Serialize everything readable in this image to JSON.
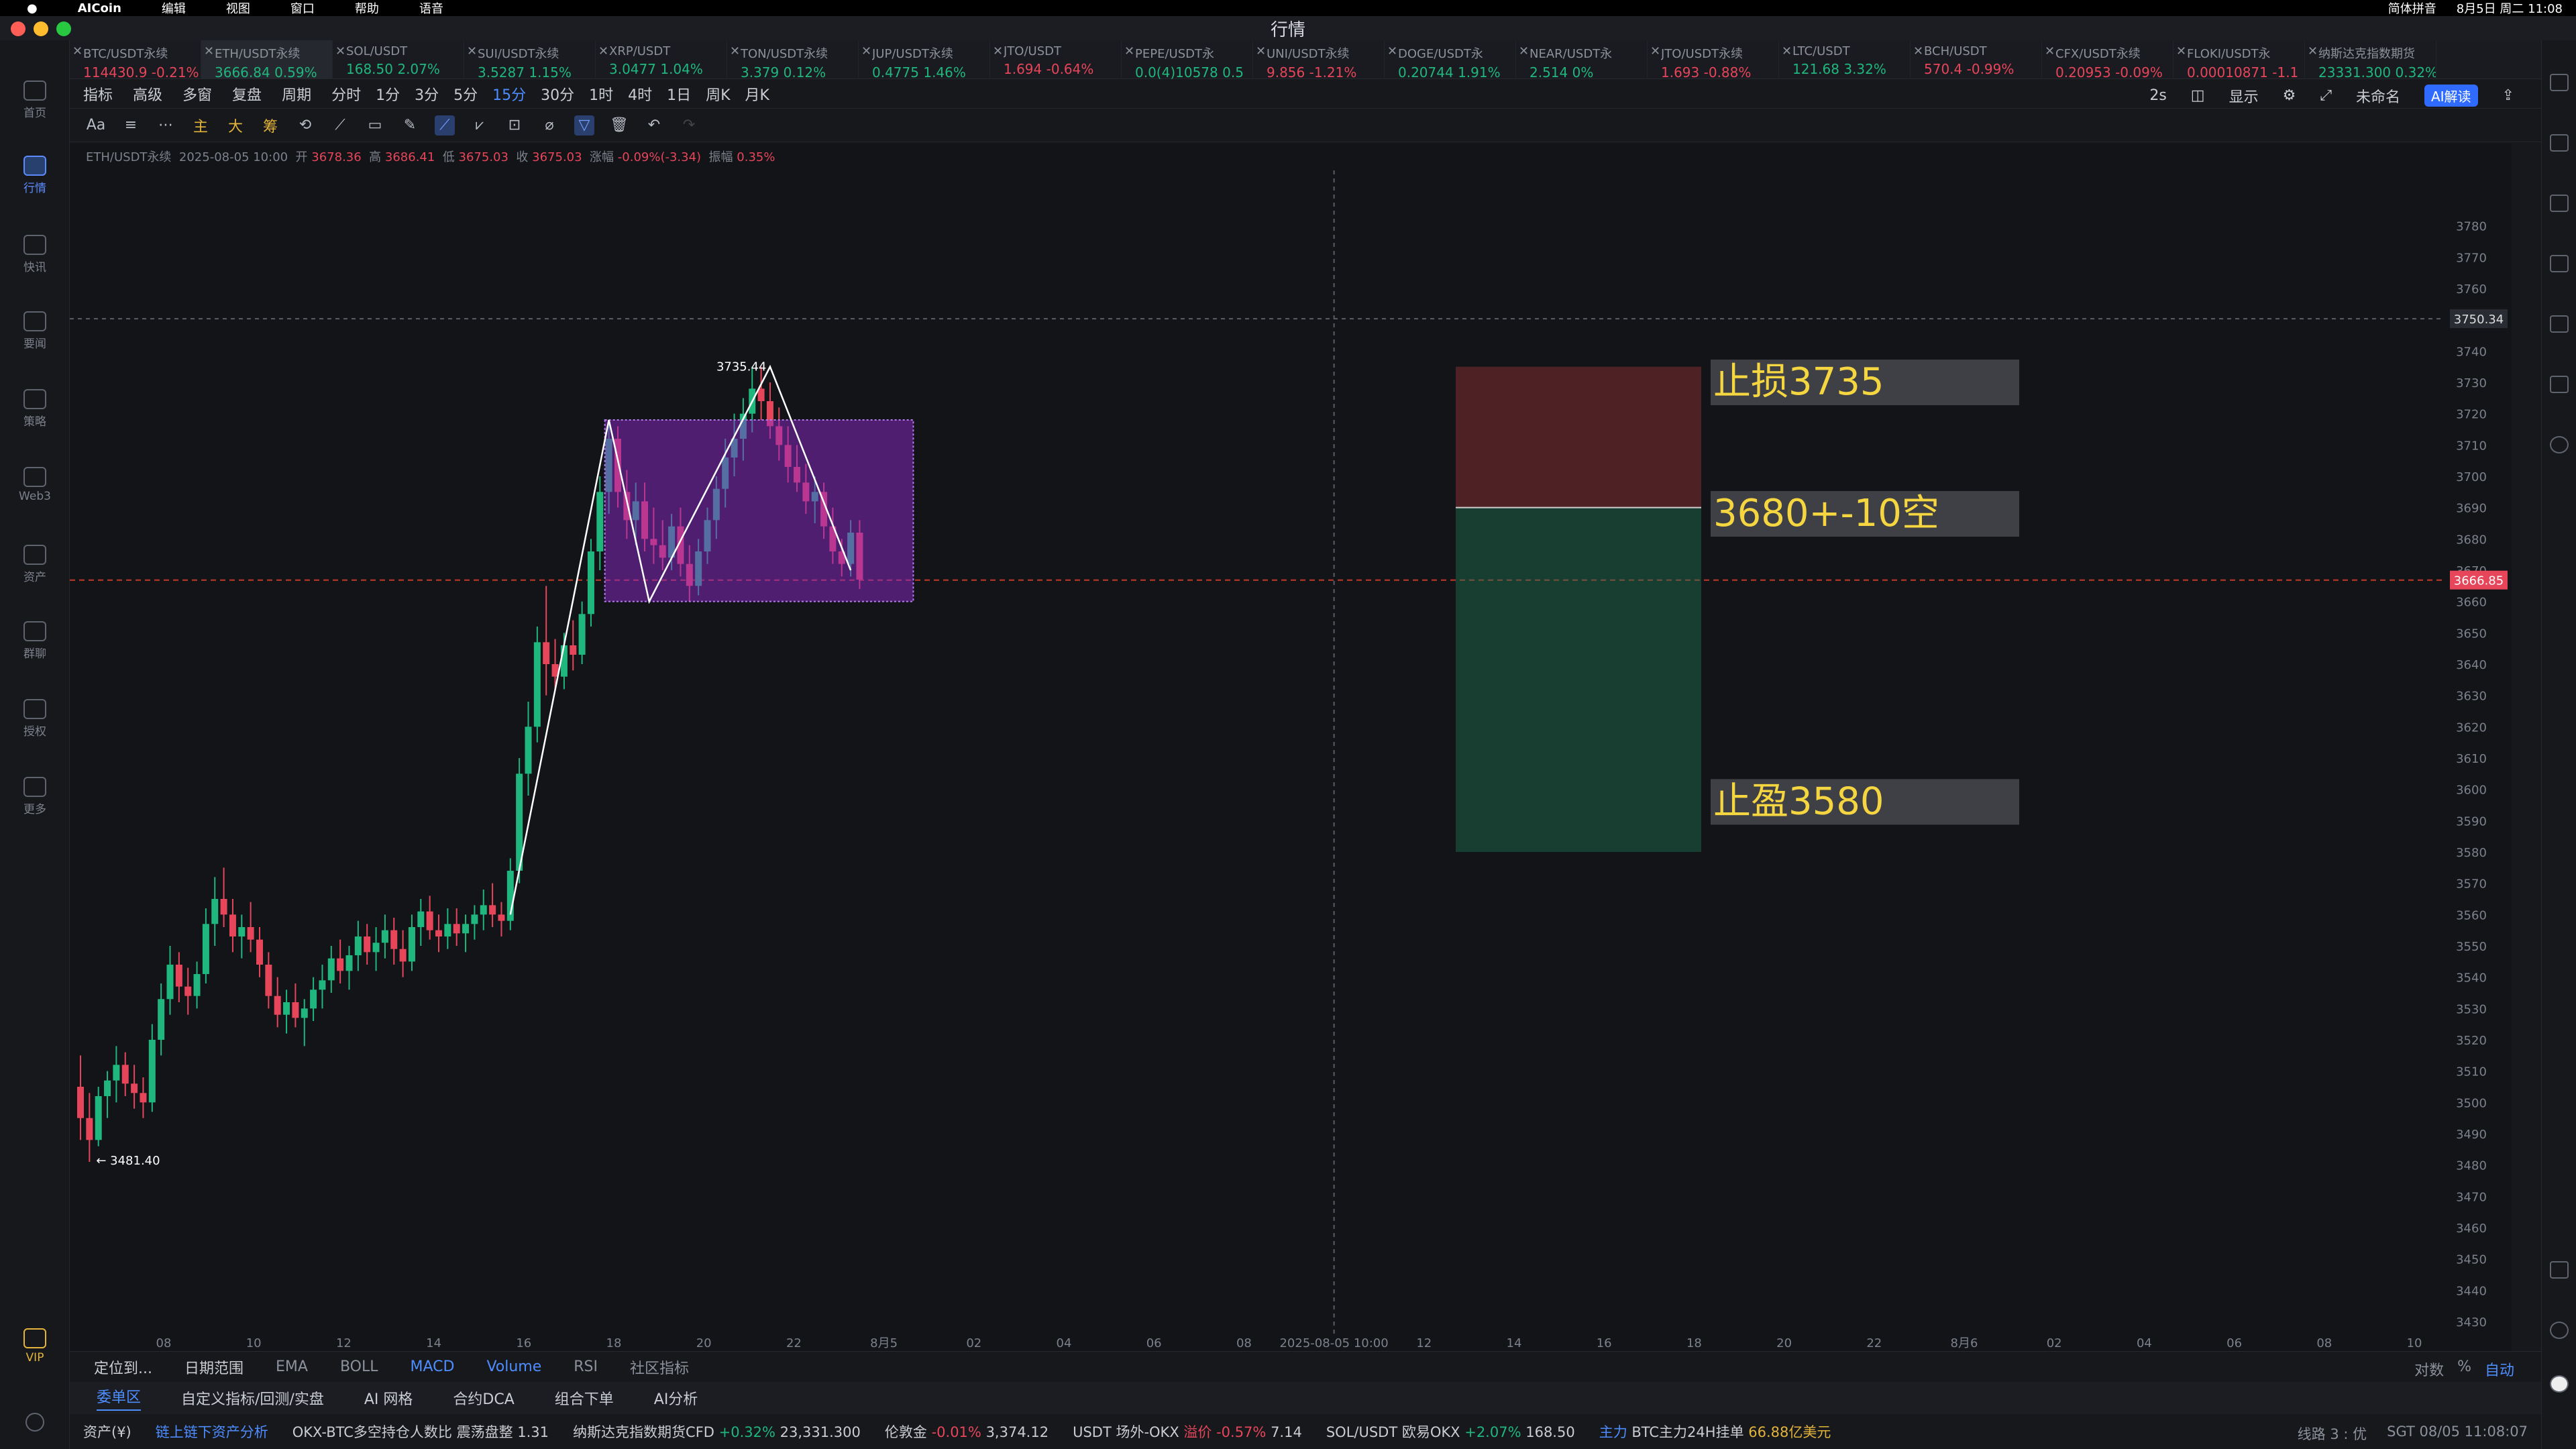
{
  "mac": {
    "app": "AICoin",
    "menus": [
      "编辑",
      "视图",
      "窗口",
      "帮助",
      "语音"
    ],
    "ime": "简体拼音",
    "datetime": "8月5日 周二 11:08"
  },
  "window": {
    "title": "行情"
  },
  "sidebar": {
    "items": [
      {
        "label": "首页",
        "icon": "home-icon"
      },
      {
        "label": "行情",
        "icon": "chart-icon",
        "active": true
      },
      {
        "label": "快讯",
        "icon": "flash-icon"
      },
      {
        "label": "要闻",
        "icon": "news-icon"
      },
      {
        "label": "策略",
        "icon": "strategy-icon"
      },
      {
        "label": "Web3",
        "icon": "web3-icon"
      },
      {
        "label": "资产",
        "icon": "wallet-icon"
      },
      {
        "label": "群聊",
        "icon": "chat-icon"
      },
      {
        "label": "授权",
        "icon": "auth-icon"
      },
      {
        "label": "更多",
        "icon": "more-icon"
      },
      {
        "label": "VIP",
        "icon": "vip-icon"
      }
    ]
  },
  "tickers": [
    {
      "name": "BTC/USDT永续",
      "price": "114430.9",
      "change": "-0.21%",
      "dir": "dn"
    },
    {
      "name": "ETH/USDT永续",
      "price": "3666.84",
      "change": "0.59%",
      "dir": "up",
      "active": true
    },
    {
      "name": "SOL/USDT",
      "price": "168.50",
      "change": "2.07%",
      "dir": "up"
    },
    {
      "name": "SUI/USDT永续",
      "price": "3.5287",
      "change": "1.15%",
      "dir": "up"
    },
    {
      "name": "XRP/USDT",
      "price": "3.0477",
      "change": "1.04%",
      "dir": "up"
    },
    {
      "name": "TON/USDT永续",
      "price": "3.379",
      "change": "0.12%",
      "dir": "up"
    },
    {
      "name": "JUP/USDT永续",
      "price": "0.4775",
      "change": "1.46%",
      "dir": "up"
    },
    {
      "name": "JTO/USDT",
      "price": "1.694",
      "change": "-0.64%",
      "dir": "dn"
    },
    {
      "name": "PEPE/USDT永",
      "price": "0.0(4)10578",
      "change": "0.5",
      "dir": "up"
    },
    {
      "name": "UNI/USDT永续",
      "price": "9.856",
      "change": "-1.21%",
      "dir": "dn"
    },
    {
      "name": "DOGE/USDT永",
      "price": "0.20744",
      "change": "1.91%",
      "dir": "up"
    },
    {
      "name": "NEAR/USDT永",
      "price": "2.514",
      "change": "0%",
      "dir": "up"
    },
    {
      "name": "JTO/USDT永续",
      "price": "1.693",
      "change": "-0.88%",
      "dir": "dn"
    },
    {
      "name": "LTC/USDT",
      "price": "121.68",
      "change": "3.32%",
      "dir": "up"
    },
    {
      "name": "BCH/USDT",
      "price": "570.4",
      "change": "-0.99%",
      "dir": "dn"
    },
    {
      "name": "CFX/USDT永续",
      "price": "0.20953",
      "change": "-0.09%",
      "dir": "dn"
    },
    {
      "name": "FLOKI/USDT永",
      "price": "0.00010871",
      "change": "-1.1",
      "dir": "dn"
    },
    {
      "name": "纳斯达克指数期货",
      "price": "23331.300",
      "change": "0.32%",
      "dir": "up"
    }
  ],
  "toolbar": {
    "items": [
      "指标",
      "高级",
      "多窗",
      "复盘",
      "周期"
    ],
    "intervals": [
      "分时",
      "1分",
      "3分",
      "5分",
      "15分",
      "30分",
      "1时",
      "4时",
      "1日",
      "周K",
      "月K"
    ],
    "active_interval": "15分",
    "right": [
      "2s",
      "显示",
      "未命名"
    ],
    "ai_label": "AI解读",
    "draw_tools": [
      "Aa",
      "主",
      "大",
      "筹"
    ]
  },
  "infoline": {
    "symbol": "ETH/USDT永续",
    "time": "2025-08-05 10:00",
    "open_label": "开",
    "open": "3678.36",
    "high_label": "高",
    "high": "3686.41",
    "low_label": "低",
    "low": "3675.03",
    "close_label": "收",
    "close": "3675.03",
    "chg_label": "涨幅",
    "chg": "-0.09%(-3.34)",
    "amp_label": "振幅",
    "amp": "0.35%"
  },
  "chart_data": {
    "type": "candlestick",
    "symbol": "ETH/USDT永续",
    "interval": "15分",
    "ylim": [
      3430,
      3790
    ],
    "y_ticks": [
      3780,
      3770,
      3760,
      3750,
      3740,
      3730,
      3720,
      3710,
      3700,
      3690,
      3680,
      3670,
      3660,
      3650,
      3640,
      3630,
      3620,
      3610,
      3600,
      3590,
      3580,
      3570,
      3560,
      3550,
      3540,
      3530,
      3520,
      3510,
      3500,
      3490,
      3480,
      3470,
      3460,
      3450,
      3440,
      3430
    ],
    "x_ticks": [
      "08",
      "10",
      "12",
      "14",
      "16",
      "18",
      "20",
      "22",
      "8月5",
      "02",
      "04",
      "06",
      "08",
      "2025-08-05 10:00",
      "12",
      "14",
      "16",
      "18",
      "20",
      "22",
      "8月6",
      "02",
      "04",
      "06",
      "08",
      "10"
    ],
    "crosshair_price": "3750.34",
    "current_price": "3666.85",
    "high_label": "3735.44",
    "low_label": "3481.40",
    "candles": [
      [
        3505,
        3515,
        3488,
        3495
      ],
      [
        3495,
        3503,
        3481,
        3488
      ],
      [
        3488,
        3505,
        3486,
        3502
      ],
      [
        3502,
        3510,
        3495,
        3507
      ],
      [
        3507,
        3518,
        3500,
        3512
      ],
      [
        3512,
        3516,
        3502,
        3506
      ],
      [
        3506,
        3512,
        3498,
        3503
      ],
      [
        3503,
        3508,
        3495,
        3500
      ],
      [
        3500,
        3525,
        3497,
        3520
      ],
      [
        3520,
        3538,
        3515,
        3533
      ],
      [
        3533,
        3550,
        3528,
        3544
      ],
      [
        3544,
        3548,
        3532,
        3537
      ],
      [
        3537,
        3543,
        3528,
        3534
      ],
      [
        3534,
        3545,
        3530,
        3541
      ],
      [
        3541,
        3562,
        3538,
        3557
      ],
      [
        3557,
        3572,
        3550,
        3565
      ],
      [
        3565,
        3575,
        3556,
        3560
      ],
      [
        3560,
        3565,
        3548,
        3553
      ],
      [
        3553,
        3560,
        3546,
        3556
      ],
      [
        3556,
        3564,
        3548,
        3552
      ],
      [
        3552,
        3556,
        3540,
        3544
      ],
      [
        3544,
        3548,
        3530,
        3534
      ],
      [
        3534,
        3540,
        3524,
        3528
      ],
      [
        3528,
        3536,
        3522,
        3532
      ],
      [
        3532,
        3538,
        3524,
        3527
      ],
      [
        3527,
        3533,
        3518,
        3530
      ],
      [
        3530,
        3540,
        3526,
        3536
      ],
      [
        3536,
        3544,
        3530,
        3539
      ],
      [
        3539,
        3550,
        3535,
        3546
      ],
      [
        3546,
        3552,
        3538,
        3542
      ],
      [
        3542,
        3550,
        3536,
        3547
      ],
      [
        3547,
        3558,
        3542,
        3553
      ],
      [
        3553,
        3557,
        3544,
        3548
      ],
      [
        3548,
        3556,
        3542,
        3551
      ],
      [
        3551,
        3560,
        3546,
        3555
      ],
      [
        3555,
        3559,
        3544,
        3549
      ],
      [
        3549,
        3555,
        3540,
        3545
      ],
      [
        3545,
        3560,
        3542,
        3556
      ],
      [
        3556,
        3565,
        3550,
        3561
      ],
      [
        3561,
        3566,
        3552,
        3555
      ],
      [
        3555,
        3560,
        3548,
        3553
      ],
      [
        3553,
        3562,
        3549,
        3557
      ],
      [
        3557,
        3562,
        3550,
        3554
      ],
      [
        3554,
        3560,
        3548,
        3557
      ],
      [
        3557,
        3563,
        3552,
        3560
      ],
      [
        3560,
        3568,
        3555,
        3563
      ],
      [
        3563,
        3570,
        3556,
        3560
      ],
      [
        3560,
        3564,
        3553,
        3558
      ],
      [
        3558,
        3578,
        3555,
        3574
      ],
      [
        3574,
        3610,
        3570,
        3605
      ],
      [
        3605,
        3628,
        3598,
        3620
      ],
      [
        3620,
        3652,
        3615,
        3647
      ],
      [
        3647,
        3665,
        3630,
        3640
      ],
      [
        3640,
        3648,
        3632,
        3636
      ],
      [
        3636,
        3650,
        3632,
        3646
      ],
      [
        3646,
        3654,
        3638,
        3643
      ],
      [
        3643,
        3660,
        3640,
        3656
      ],
      [
        3656,
        3680,
        3652,
        3676
      ],
      [
        3676,
        3700,
        3670,
        3695
      ],
      [
        3695,
        3718,
        3688,
        3712
      ],
      [
        3712,
        3716,
        3690,
        3695
      ],
      [
        3695,
        3702,
        3680,
        3686
      ],
      [
        3686,
        3698,
        3678,
        3692
      ],
      [
        3692,
        3698,
        3676,
        3680
      ],
      [
        3680,
        3690,
        3672,
        3678
      ],
      [
        3678,
        3686,
        3670,
        3674
      ],
      [
        3674,
        3688,
        3670,
        3684
      ],
      [
        3684,
        3690,
        3668,
        3672
      ],
      [
        3672,
        3678,
        3660,
        3665
      ],
      [
        3665,
        3680,
        3662,
        3676
      ],
      [
        3676,
        3690,
        3672,
        3686
      ],
      [
        3686,
        3700,
        3680,
        3696
      ],
      [
        3696,
        3712,
        3690,
        3706
      ],
      [
        3706,
        3720,
        3700,
        3712
      ],
      [
        3712,
        3725,
        3705,
        3720
      ],
      [
        3720,
        3735,
        3714,
        3728
      ],
      [
        3728,
        3735,
        3718,
        3724
      ],
      [
        3724,
        3730,
        3712,
        3716
      ],
      [
        3716,
        3722,
        3705,
        3710
      ],
      [
        3710,
        3716,
        3698,
        3703
      ],
      [
        3703,
        3710,
        3695,
        3698
      ],
      [
        3698,
        3704,
        3688,
        3692
      ],
      [
        3692,
        3700,
        3685,
        3695
      ],
      [
        3695,
        3698,
        3680,
        3684
      ],
      [
        3684,
        3690,
        3672,
        3676
      ],
      [
        3676,
        3680,
        3668,
        3672
      ],
      [
        3672,
        3686,
        3668,
        3682
      ],
      [
        3682,
        3686,
        3664,
        3667
      ]
    ]
  },
  "annotations": {
    "stop_loss": "止损3735",
    "entry": "3680+-10空",
    "take_profit": "止盈3580"
  },
  "bottombar": {
    "left": [
      "定位到...",
      "日期范围"
    ],
    "indicators": [
      "EMA",
      "BOLL",
      "MACD",
      "Volume",
      "RSI",
      "社区指标"
    ],
    "right": [
      "对数",
      "%",
      "自动"
    ]
  },
  "statusrow": [
    "委单区",
    "自定义指标/回测/实盘",
    "AI 网格",
    "合约DCA",
    "组合下单",
    "AI分析"
  ],
  "footer": {
    "assets": "资产(¥)",
    "link": "链上链下资产分析",
    "items": [
      {
        "label": "OKX-BTC多空持仓人数比",
        "tag": "震荡盘整",
        "value": "1.31"
      },
      {
        "label": "纳斯达克指数期货CFD",
        "tag": "+0.32%",
        "value": "23,331.300"
      },
      {
        "label": "伦敦金",
        "tag": "-0.01%",
        "value": "3,374.12"
      },
      {
        "label": "USDT 场外-OKX",
        "tag": "溢价 -0.57%",
        "value": "7.14"
      },
      {
        "label": "SOL/USDT 欧易OKX",
        "tag": "+2.07%",
        "value": "168.50"
      },
      {
        "label": "主力",
        "tag": "BTC主力24H挂单",
        "value": "66.88亿美元"
      }
    ],
    "line": "线路 3 : 优",
    "time": "SGT 08/05 11:08:07"
  }
}
